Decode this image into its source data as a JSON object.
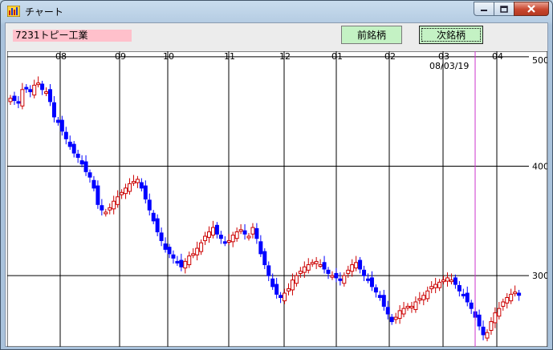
{
  "window": {
    "title": "チャート",
    "min_icon": "minimize-icon",
    "max_icon": "maximize-icon",
    "close_icon": "close-icon"
  },
  "toolbar": {
    "stock_label": "7231トピー工業",
    "prev_button": "前銘柄",
    "next_button": "次銘柄"
  },
  "chart_data": {
    "type": "candlestick",
    "ylim": [
      235,
      505
    ],
    "y_ticks": [
      "500",
      "400",
      "300"
    ],
    "x_month_labels": [
      "08",
      "09",
      "10",
      "11",
      "12",
      "01",
      "02",
      "03",
      "04"
    ],
    "cursor_date_label": "08/03/19",
    "colors": {
      "up": "#cc0000",
      "down": "#0000ff",
      "grid": "#000000",
      "cursor": "#cc33cc"
    },
    "candles_close": [
      462,
      460,
      458,
      470,
      471,
      468,
      474,
      476,
      470,
      468,
      459,
      445,
      440,
      432,
      425,
      418,
      412,
      408,
      402,
      395,
      390,
      380,
      365,
      360,
      358,
      362,
      368,
      372,
      376,
      380,
      384,
      386,
      388,
      380,
      370,
      360,
      350,
      340,
      332,
      324,
      320,
      316,
      312,
      308,
      313,
      318,
      320,
      325,
      330,
      336,
      340,
      344,
      338,
      334,
      330,
      332,
      337,
      340,
      342,
      338,
      336,
      344,
      334,
      320,
      310,
      300,
      290,
      283,
      280,
      284,
      288,
      296,
      300,
      304,
      308,
      310,
      312,
      313,
      310,
      306,
      302,
      300,
      298,
      296,
      300,
      305,
      310,
      312,
      306,
      300,
      296,
      290,
      285,
      280,
      272,
      265,
      258,
      262,
      268,
      270,
      272,
      272,
      276,
      279,
      282,
      286,
      290,
      292,
      294,
      296,
      298,
      296,
      292,
      286,
      282,
      276,
      270,
      262,
      254,
      246,
      248,
      258,
      266,
      270,
      276,
      280,
      283,
      285,
      282
    ]
  }
}
